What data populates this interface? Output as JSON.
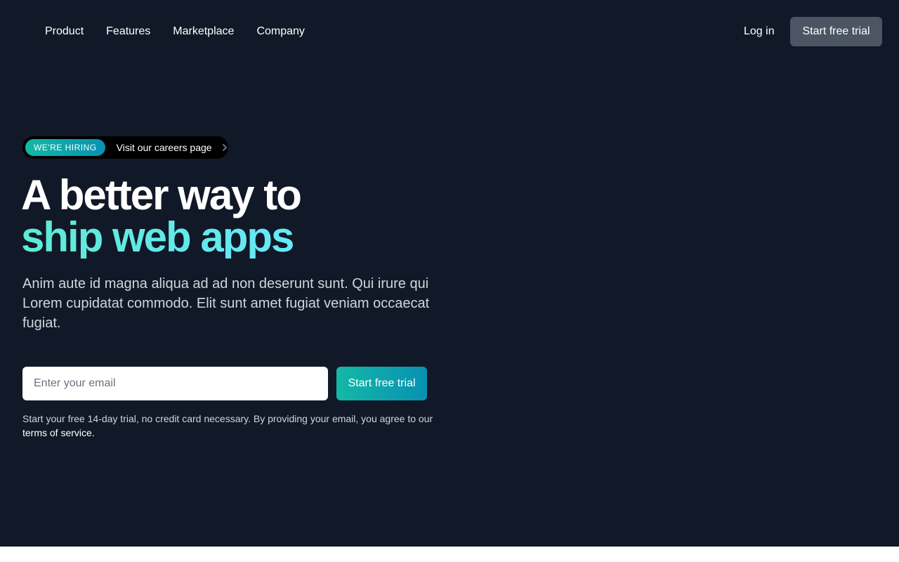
{
  "nav": {
    "links": [
      "Product",
      "Features",
      "Marketplace",
      "Company"
    ],
    "login": "Log in",
    "cta": "Start free trial"
  },
  "hero": {
    "pill_badge": "We're hiring",
    "pill_text": "Visit our careers page",
    "headline_line1": "A better way to",
    "headline_line2": "ship web apps",
    "lead": "Anim aute id magna aliqua ad ad non deserunt sunt. Qui irure qui Lorem cupidatat commodo. Elit sunt amet fugiat veniam occaecat fugiat.",
    "email_placeholder": "Enter your email",
    "form_cta": "Start free trial",
    "fineprint": "Start your free 14-day trial, no credit card necessary. By providing your email, you agree to our ",
    "terms_link": "terms of service."
  },
  "colors": {
    "background": "#111827",
    "accent_from": "#14b8a6",
    "accent_to": "#0891b2",
    "headline_accent": "#67e8f9",
    "nav_cta_bg": "#4b5563"
  },
  "icons": {
    "pill_chevron": "chevron-right-icon"
  }
}
